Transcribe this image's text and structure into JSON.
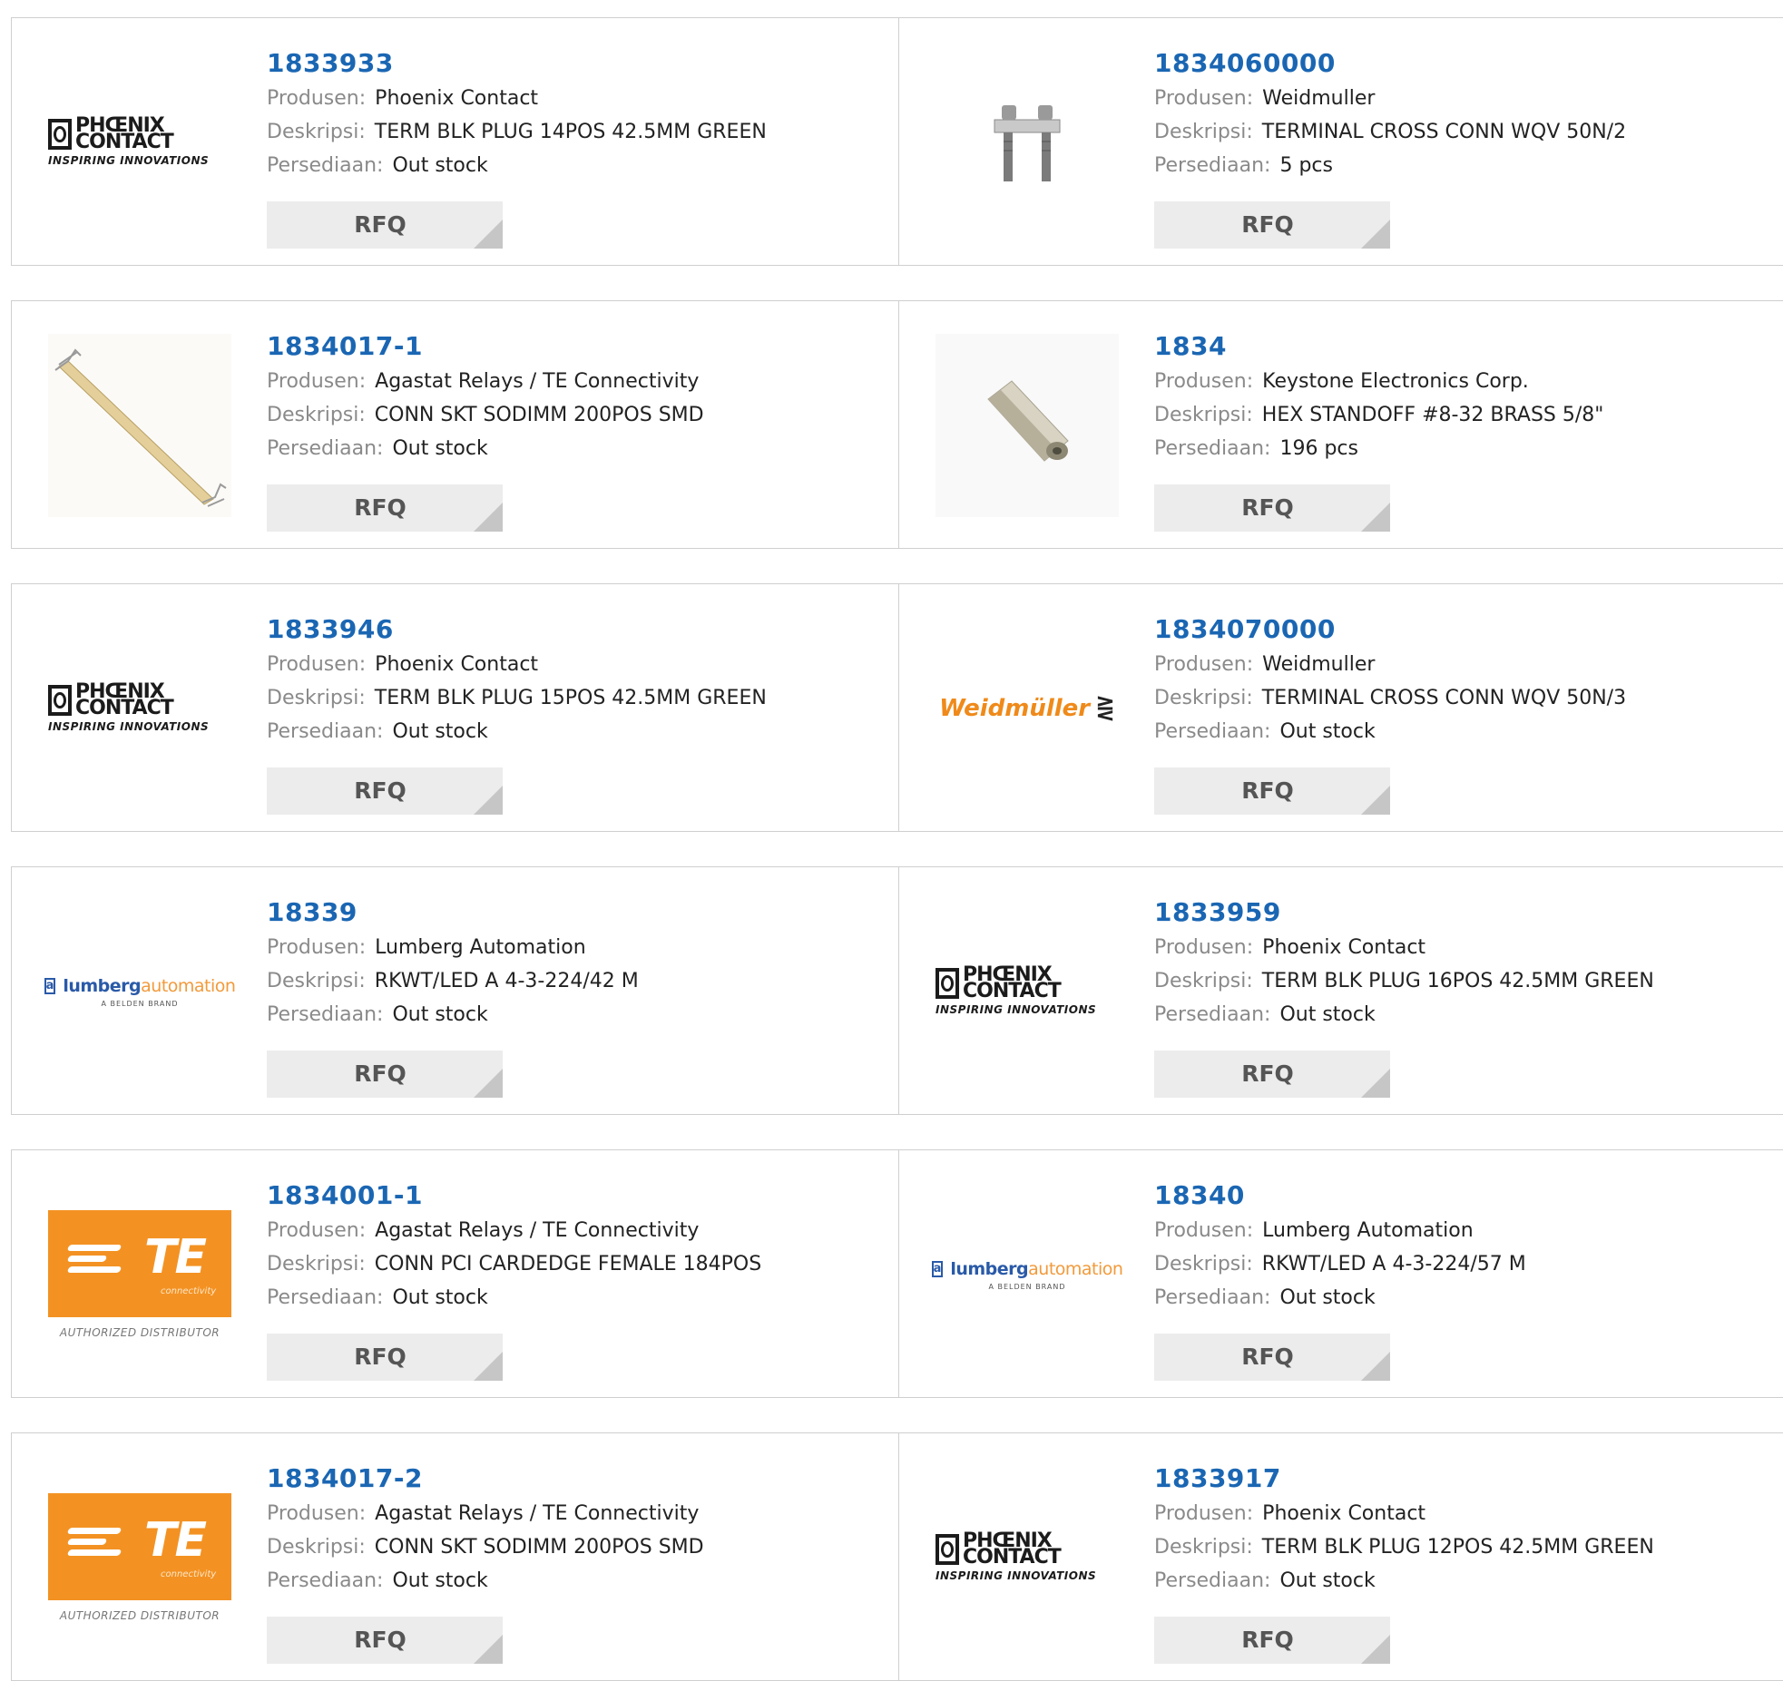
{
  "labels": {
    "manufacturer": "Produsen:",
    "description": "Deskripsi:",
    "stock": "Persediaan:",
    "rfq": "RFQ"
  },
  "rows": [
    [
      {
        "part": "1833933",
        "manufacturer": "Phoenix Contact",
        "description": "TERM BLK PLUG 14POS 42.5MM GREEN",
        "stock": "Out stock",
        "logo": "phoenix",
        "logo_text": [
          "PHŒNIX",
          "CONTACT",
          "INSPIRING INNOVATIONS"
        ]
      },
      {
        "part": "1834060000",
        "manufacturer": "Weidmuller",
        "description": "TERMINAL CROSS CONN WQV 50N/2",
        "stock": "5 pcs",
        "logo": "crossconn-photo"
      }
    ],
    [
      {
        "part": "1834017-1",
        "manufacturer": "Agastat Relays / TE Connectivity",
        "description": "CONN SKT SODIMM 200POS SMD",
        "stock": "Out stock",
        "logo": "sodimm-photo"
      },
      {
        "part": "1834",
        "manufacturer": "Keystone Electronics Corp.",
        "description": "HEX STANDOFF #8-32 BRASS 5/8\"",
        "stock": "196 pcs",
        "logo": "standoff-photo"
      }
    ],
    [
      {
        "part": "1833946",
        "manufacturer": "Phoenix Contact",
        "description": "TERM BLK PLUG 15POS 42.5MM GREEN",
        "stock": "Out stock",
        "logo": "phoenix",
        "logo_text": [
          "PHŒNIX",
          "CONTACT",
          "INSPIRING INNOVATIONS"
        ]
      },
      {
        "part": "1834070000",
        "manufacturer": "Weidmuller",
        "description": "TERMINAL CROSS CONN WQV 50N/3",
        "stock": "Out stock",
        "logo": "weidmuller",
        "logo_text": [
          "Weidmüller",
          "⋛"
        ]
      }
    ],
    [
      {
        "part": "18339",
        "manufacturer": "Lumberg Automation",
        "description": "RKWT/LED A 4-3-224/42 M",
        "stock": "Out stock",
        "logo": "lumberg",
        "logo_text": [
          "a",
          "lumberg",
          "automation",
          "A BELDEN BRAND"
        ]
      },
      {
        "part": "1833959",
        "manufacturer": "Phoenix Contact",
        "description": "TERM BLK PLUG 16POS 42.5MM GREEN",
        "stock": "Out stock",
        "logo": "phoenix",
        "logo_text": [
          "PHŒNIX",
          "CONTACT",
          "INSPIRING INNOVATIONS"
        ]
      }
    ],
    [
      {
        "part": "1834001-1",
        "manufacturer": "Agastat Relays / TE Connectivity",
        "description": "CONN PCI CARDEDGE FEMALE 184POS",
        "stock": "Out stock",
        "logo": "te",
        "logo_text": [
          "TE",
          "connectivity",
          "AUTHORIZED DISTRIBUTOR"
        ]
      },
      {
        "part": "18340",
        "manufacturer": "Lumberg Automation",
        "description": "RKWT/LED A 4-3-224/57 M",
        "stock": "Out stock",
        "logo": "lumberg",
        "logo_text": [
          "a",
          "lumberg",
          "automation",
          "A BELDEN BRAND"
        ]
      }
    ],
    [
      {
        "part": "1834017-2",
        "manufacturer": "Agastat Relays / TE Connectivity",
        "description": "CONN SKT SODIMM 200POS SMD",
        "stock": "Out stock",
        "logo": "te",
        "logo_text": [
          "TE",
          "connectivity",
          "AUTHORIZED DISTRIBUTOR"
        ]
      },
      {
        "part": "1833917",
        "manufacturer": "Phoenix Contact",
        "description": "TERM BLK PLUG 12POS 42.5MM GREEN",
        "stock": "Out stock",
        "logo": "phoenix",
        "logo_text": [
          "PHŒNIX",
          "CONTACT",
          "INSPIRING INNOVATIONS"
        ]
      }
    ]
  ]
}
